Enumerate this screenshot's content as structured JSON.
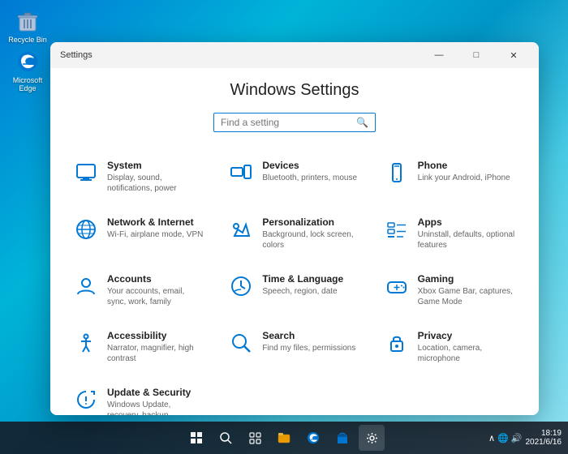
{
  "desktop": {
    "icons": [
      {
        "id": "recycle-bin",
        "label": "Recycle Bin",
        "icon": "🗑️"
      },
      {
        "id": "microsoft-edge",
        "label": "Microsoft Edge",
        "icon": "🌐"
      }
    ]
  },
  "taskbar": {
    "time": "18:19",
    "date": "2021/6/16",
    "icons": [
      {
        "id": "start",
        "symbol": "⊞"
      },
      {
        "id": "search",
        "symbol": "🔍"
      },
      {
        "id": "task-view",
        "symbol": "❑"
      },
      {
        "id": "file-explorer",
        "symbol": "📁"
      },
      {
        "id": "edge",
        "symbol": "🌐"
      },
      {
        "id": "store",
        "symbol": "🛍️"
      },
      {
        "id": "settings",
        "symbol": "⚙️"
      }
    ]
  },
  "settings_window": {
    "title": "Settings",
    "heading": "Windows Settings",
    "search_placeholder": "Find a setting",
    "window_controls": {
      "minimize": "—",
      "maximize": "□",
      "close": "✕"
    },
    "items": [
      {
        "id": "system",
        "name": "System",
        "desc": "Display, sound, notifications, power",
        "icon": "system"
      },
      {
        "id": "devices",
        "name": "Devices",
        "desc": "Bluetooth, printers, mouse",
        "icon": "devices"
      },
      {
        "id": "phone",
        "name": "Phone",
        "desc": "Link your Android, iPhone",
        "icon": "phone"
      },
      {
        "id": "network",
        "name": "Network & Internet",
        "desc": "Wi-Fi, airplane mode, VPN",
        "icon": "network"
      },
      {
        "id": "personalization",
        "name": "Personalization",
        "desc": "Background, lock screen, colors",
        "icon": "personalization"
      },
      {
        "id": "apps",
        "name": "Apps",
        "desc": "Uninstall, defaults, optional features",
        "icon": "apps"
      },
      {
        "id": "accounts",
        "name": "Accounts",
        "desc": "Your accounts, email, sync, work, family",
        "icon": "accounts"
      },
      {
        "id": "time-language",
        "name": "Time & Language",
        "desc": "Speech, region, date",
        "icon": "time-language"
      },
      {
        "id": "gaming",
        "name": "Gaming",
        "desc": "Xbox Game Bar, captures, Game Mode",
        "icon": "gaming"
      },
      {
        "id": "accessibility",
        "name": "Accessibility",
        "desc": "Narrator, magnifier, high contrast",
        "icon": "accessibility"
      },
      {
        "id": "search",
        "name": "Search",
        "desc": "Find my files, permissions",
        "icon": "search"
      },
      {
        "id": "privacy",
        "name": "Privacy",
        "desc": "Location, camera, microphone",
        "icon": "privacy"
      },
      {
        "id": "update-security",
        "name": "Update & Security",
        "desc": "Windows Update, recovery, backup",
        "icon": "update-security"
      }
    ]
  }
}
